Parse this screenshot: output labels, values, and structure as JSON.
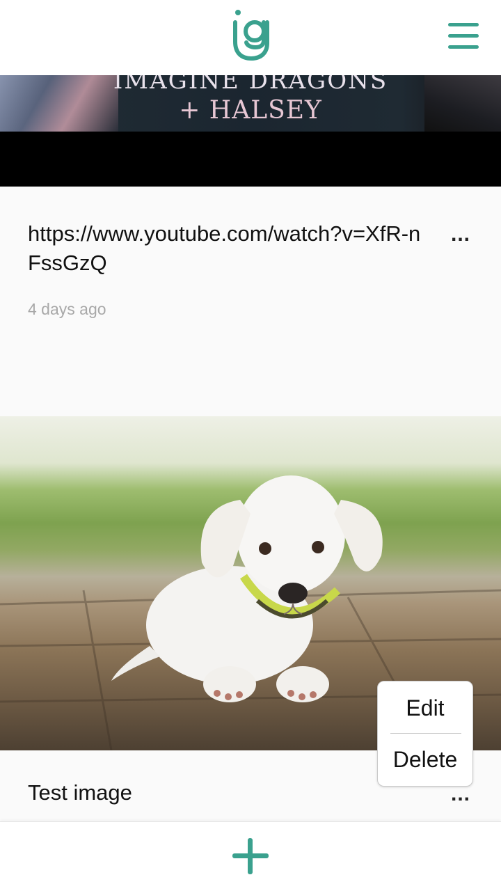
{
  "colors": {
    "accent": "#3aa18e",
    "timestamp": "#a8a8a8"
  },
  "header": {
    "logo_icon": "ig-logo-icon",
    "menu_icon": "hamburger-menu-icon"
  },
  "feed": {
    "items": [
      {
        "media": {
          "type": "video-thumbnail",
          "overlay_line1": "IMAGINE DRAGONS",
          "overlay_line2": "+ HALSEY"
        },
        "text": "https://www.youtube.com/watch?v=XfR-nFssGzQ",
        "time": "4 days ago",
        "more_label": "..."
      },
      {
        "media": {
          "type": "photo",
          "description_icon": "puppy-photo"
        },
        "text": "Test image",
        "more_label": "..."
      }
    ]
  },
  "context_menu": {
    "edit_label": "Edit",
    "delete_label": "Delete"
  },
  "bottom_bar": {
    "add_icon": "plus-icon"
  }
}
